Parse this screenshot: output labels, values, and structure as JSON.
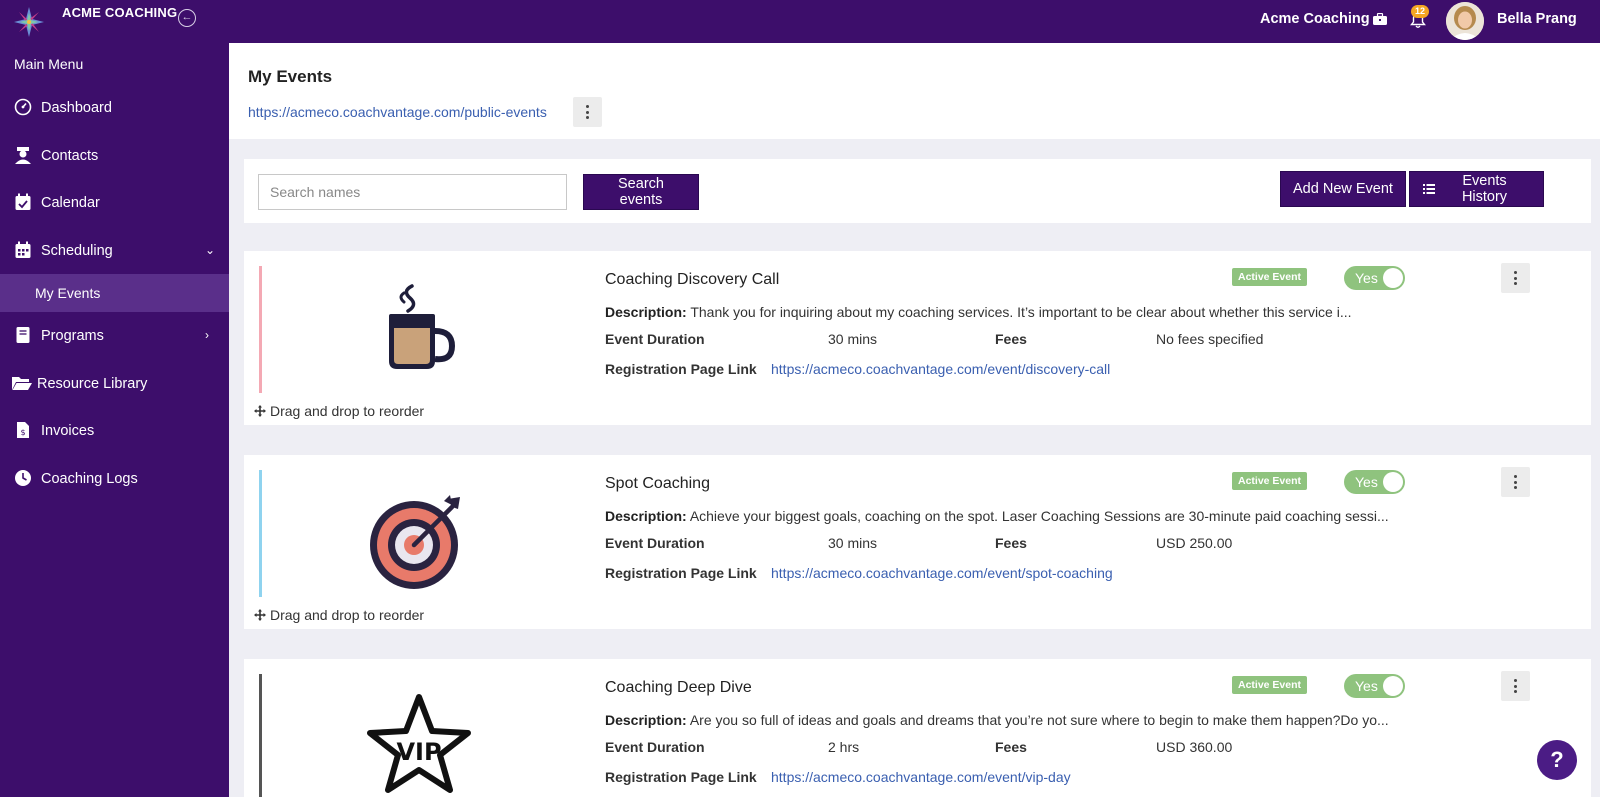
{
  "app": {
    "brand": "ACME COACHING",
    "org_name": "Acme Coaching",
    "notifications": "12",
    "user_name": "Bella Prang"
  },
  "sidebar": {
    "title": "Main Menu",
    "items": [
      {
        "label": "Dashboard",
        "icon": "speedometer-icon"
      },
      {
        "label": "Contacts",
        "icon": "contacts-icon"
      },
      {
        "label": "Calendar",
        "icon": "calendar-check-icon"
      },
      {
        "label": "Scheduling",
        "icon": "calendar-grid-icon"
      },
      {
        "label": "My Events",
        "icon": ""
      },
      {
        "label": "Programs",
        "icon": "book-icon"
      },
      {
        "label": "Resource Library",
        "icon": "folder-open-icon"
      },
      {
        "label": "Invoices",
        "icon": "invoice-icon"
      },
      {
        "label": "Coaching Logs",
        "icon": "clock-icon"
      }
    ]
  },
  "page": {
    "title": "My Events",
    "public_link": "https://acmeco.coachvantage.com/public-events"
  },
  "search": {
    "placeholder": "Search names",
    "search_button": "Search events",
    "add_button": "Add New Event",
    "history_button": "Events History"
  },
  "labels": {
    "description": "Description:",
    "duration": "Event Duration",
    "fees": "Fees",
    "registration": "Registration Page Link",
    "active_badge": "Active Event",
    "toggle": "Yes",
    "drag": "Drag and drop to reorder"
  },
  "events": [
    {
      "title": "Coaching Discovery Call",
      "description": "Thank you for inquiring about my coaching services. It’s important to be clear about whether this service i...",
      "duration": "30 mins",
      "fees": "No fees specified",
      "link": "https://acmeco.coachvantage.com/event/discovery-call",
      "accent": "#f4a9b4",
      "icon": "coffee-mug-icon"
    },
    {
      "title": "Spot Coaching",
      "description": "Achieve your biggest goals, coaching on the spot. Laser Coaching Sessions are 30-minute paid coaching sessi...",
      "duration": "30 mins",
      "fees": "USD 250.00",
      "link": "https://acmeco.coachvantage.com/event/spot-coaching",
      "accent": "#8fd3ef",
      "icon": "target-dart-icon"
    },
    {
      "title": "Coaching Deep Dive",
      "description": "Are you so full of ideas and goals and dreams that you’re not sure where to begin to make them happen?Do yo...",
      "duration": "2 hrs",
      "fees": "USD 360.00",
      "link": "https://acmeco.coachvantage.com/event/vip-day",
      "accent": "#555555",
      "icon": "vip-star-icon"
    }
  ],
  "help": "?"
}
